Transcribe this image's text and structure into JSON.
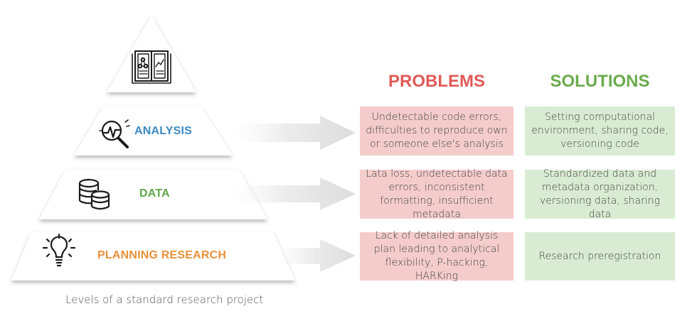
{
  "colors": {
    "analysis": "#3a8ac2",
    "data": "#5fa64a",
    "planning": "#e8913a",
    "problems": "#e05a57",
    "solutions": "#6aab4d",
    "problem_box": "#f5cccc",
    "solution_box": "#d9ecd3"
  },
  "pyramid": {
    "top_icon": "book-chart-icon",
    "levels": [
      {
        "label": "ANALYSIS",
        "icon": "magnifier-chart-icon"
      },
      {
        "label": "DATA",
        "icon": "database-icon"
      },
      {
        "label": "PLANNING RESEARCH",
        "icon": "lightbulb-icon"
      }
    ],
    "caption": "Levels of a standard research project"
  },
  "columns": {
    "problems_title": "PROBLEMS",
    "solutions_title": "SOLUTIONS"
  },
  "rows": [
    {
      "problem": "Undetectable code errors, difficulties to reproduce own or someone else's analysis",
      "solution": "Setting computational environment, sharing code, versioning code"
    },
    {
      "problem": "Lata loss, undetectable data errors, inconsistent formatting, insufficient metadata",
      "solution": "Standardized data and metadata organization, versioning data, sharing data"
    },
    {
      "problem": "Lack of detailed analysis plan leading to analytical flexibility, P-hacking, HARKing",
      "solution": "Research preregistration"
    }
  ]
}
